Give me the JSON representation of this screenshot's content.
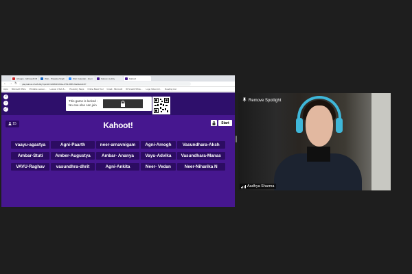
{
  "browser": {
    "tabs": [
      {
        "label": "All apps - Microsoft Office"
      },
      {
        "label": "Web - Priyanka Singh - Outlook"
      },
      {
        "label": "Web Calendar - Zoom"
      },
      {
        "label": "Kahoot | Lobby"
      },
      {
        "label": "Kahoot!"
      }
    ],
    "url": "play.kahoot.it/v2/lobby?quizId=3d3f6f3f-993a-4754-8855-f3a9fe4c447f",
    "bookmarks": [
      "Apps",
      "Microsoft Office",
      "Printable Lesson...",
      "Lesson 4 Sub &...",
      "Pre-Entry Steps",
      "Online Basic Tool",
      "Gmail - Microsoft",
      "ID Smartit White...",
      "Logo Video Intr...",
      "Reading List"
    ]
  },
  "kahoot": {
    "locked_message": "This game is locked - No one else can join",
    "player_count": "15",
    "logo": "Kahoot!",
    "start_label": "Start",
    "players": [
      "vaayu-agastya",
      "Agni-Paarth",
      "neer-arnavnigam",
      "Agni-Amogh",
      "Vasundhara-Aksh",
      "Ambar-Stuti",
      "Amber-Augustya",
      "Ambar- Ananya",
      "Vayu-Advika",
      "Vasundhara-Manas",
      "VAVU-Raghav",
      "vasundhra-dhrit",
      "Agni-Ankita",
      "Neer- Vedan",
      "Neer-Niharika N"
    ]
  },
  "webcam": {
    "spotlight_label": "Remove Spotlight",
    "participant_name": "Aadhya Sharma"
  }
}
